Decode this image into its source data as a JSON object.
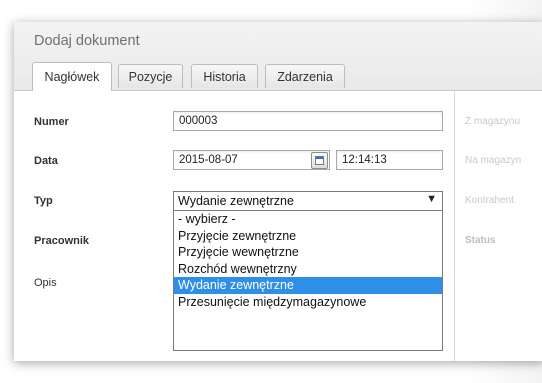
{
  "window": {
    "title": "Dodaj dokument"
  },
  "tabs": [
    {
      "label": "Nagłówek"
    },
    {
      "label": "Pozycje"
    },
    {
      "label": "Historia"
    },
    {
      "label": "Zdarzenia"
    }
  ],
  "form": {
    "numer": {
      "label": "Numer",
      "value": "000003"
    },
    "data": {
      "label": "Data",
      "date": "2015-08-07",
      "time": "12:14:13"
    },
    "typ": {
      "label": "Typ",
      "selected": "Wydanie zewnętrzne",
      "options": [
        "- wybierz -",
        "Przyjęcie zewnętrzne",
        "Przyjęcie wewnętrzne",
        "Rozchód wewnętrzny",
        "Wydanie zewnętrzne",
        "Przesunięcie międzymagazynowe"
      ],
      "highlighted_option": "Wydanie zewnętrzne"
    },
    "pracownik": {
      "label": "Pracownik"
    },
    "opis": {
      "label": "Opis"
    }
  },
  "right_labels": {
    "z_magazynu": "Z magazynu",
    "na_magazyn": "Na magazyn",
    "kontrahent": "Kontrahent",
    "status": "Status"
  },
  "colors": {
    "highlight": "#2f8fe6",
    "header_bg": "#efefef"
  }
}
